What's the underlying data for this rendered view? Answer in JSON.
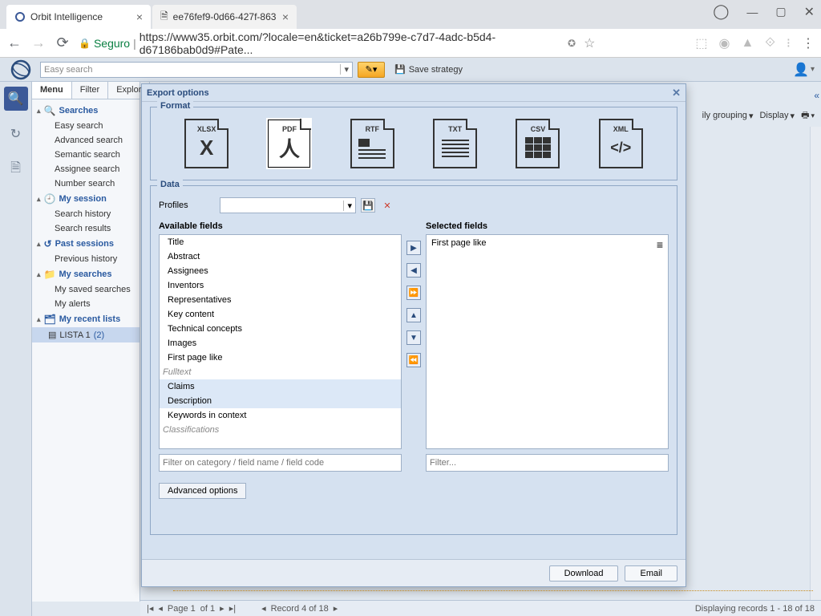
{
  "browser": {
    "tabs": [
      {
        "title": "Orbit Intelligence",
        "active": true
      },
      {
        "title": "ee76fef9-0d66-427f-863",
        "active": false
      }
    ],
    "secure_label": "Seguro",
    "url": "https://www35.orbit.com/?locale=en&ticket=a26b799e-c7d7-4adc-b5d4-d67186bab0d9#Pate..."
  },
  "topbar": {
    "search_placeholder": "Easy search",
    "save_strategy": "Save strategy"
  },
  "sidebar": {
    "tabs": [
      "Menu",
      "Filter",
      "Explor"
    ],
    "groups": [
      {
        "label": "Searches",
        "items": [
          "Easy search",
          "Advanced search",
          "Semantic search",
          "Assignee search",
          "Number search"
        ]
      },
      {
        "label": "My session",
        "items": [
          "Search history",
          "Search results"
        ]
      },
      {
        "label": "Past sessions",
        "items": [
          "Previous history"
        ]
      },
      {
        "label": "My searches",
        "items": [
          "My saved searches",
          "My alerts"
        ]
      },
      {
        "label": "My recent lists",
        "items": []
      }
    ],
    "selected_list": {
      "name": "LISTA 1",
      "count": "(2)"
    }
  },
  "content_toolbar": {
    "grouping": "ily grouping",
    "display": "Display"
  },
  "modal": {
    "title": "Export options",
    "format_legend": "Format",
    "formats": [
      "XLSX",
      "PDF",
      "RTF",
      "TXT",
      "CSV",
      "XML"
    ],
    "selected_format": "PDF",
    "data_legend": "Data",
    "profiles_label": "Profiles",
    "available_label": "Available fields",
    "selected_label": "Selected fields",
    "available": {
      "items": [
        "Title",
        "Abstract",
        "Assignees",
        "Inventors",
        "Representatives",
        "Key content",
        "Technical concepts",
        "Images",
        "First page like"
      ],
      "fulltext_cat": "Fulltext",
      "fulltext_items": [
        "Claims",
        "Description",
        "Keywords in context"
      ],
      "class_cat": "Classifications"
    },
    "selected_item": "First page like",
    "filter_available_ph": "Filter on category / field name / field code",
    "filter_selected_ph": "Filter...",
    "advanced_label": "Advanced options",
    "download": "Download",
    "email": "Email"
  },
  "footer": {
    "page_label": "Page 1",
    "of_label": "of 1",
    "record_label": "Record 4 of 18",
    "display_records": "Displaying records 1 - 18 of 18"
  }
}
